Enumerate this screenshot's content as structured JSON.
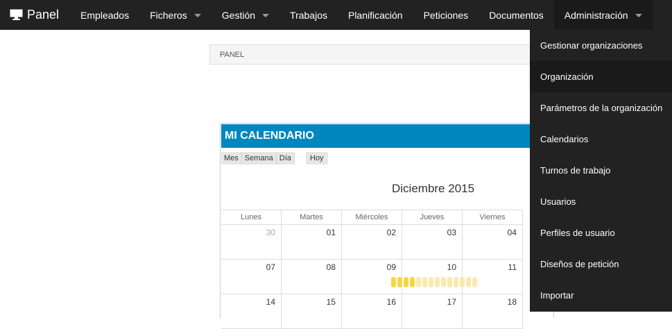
{
  "navbar": {
    "brand": "Panel",
    "items": [
      {
        "label": "Empleados",
        "caret": false
      },
      {
        "label": "Ficheros",
        "caret": true
      },
      {
        "label": "Gestión",
        "caret": true
      },
      {
        "label": "Trabajos",
        "caret": false
      },
      {
        "label": "Planificación",
        "caret": false
      },
      {
        "label": "Peticiones",
        "caret": false
      },
      {
        "label": "Documentos",
        "caret": false
      },
      {
        "label": "Administración",
        "caret": true
      }
    ]
  },
  "breadcrumb": {
    "label": "PANEL"
  },
  "calendar": {
    "header": "MI CALENDARIO",
    "views": [
      "Mes",
      "Semana",
      "Día"
    ],
    "today": "Hoy",
    "title": "Diciembre 2015",
    "weekdays": [
      "Lunes",
      "Martes",
      "Miércoles",
      "Jueves",
      "Viernes"
    ],
    "weeks": [
      [
        "30",
        "01",
        "02",
        "03",
        "04"
      ],
      [
        "07",
        "08",
        "09",
        "10",
        "11"
      ],
      [
        "14",
        "15",
        "16",
        "17",
        "18"
      ]
    ],
    "muted_days": [
      "30"
    ],
    "bar_colors": [
      "#f6d743",
      "#f6d743",
      "#f6d743",
      "#f6d743",
      "#f9eab0",
      "#f9eab0",
      "#f9eab0",
      "#f9eab0",
      "#f9eab0",
      "#f9eab0",
      "#f9eab0",
      "#f9eab0",
      "#f9eab0",
      "#f9eab0"
    ]
  },
  "dropdown": {
    "items": [
      "Gestionar organizaciones",
      "Organización",
      "Parámetros de la organización",
      "Calendarios",
      "Turnos de trabajo",
      "Usuarios",
      "Perfiles de usuario",
      "Diseños de petición",
      "Importar"
    ],
    "active_index": 1
  }
}
